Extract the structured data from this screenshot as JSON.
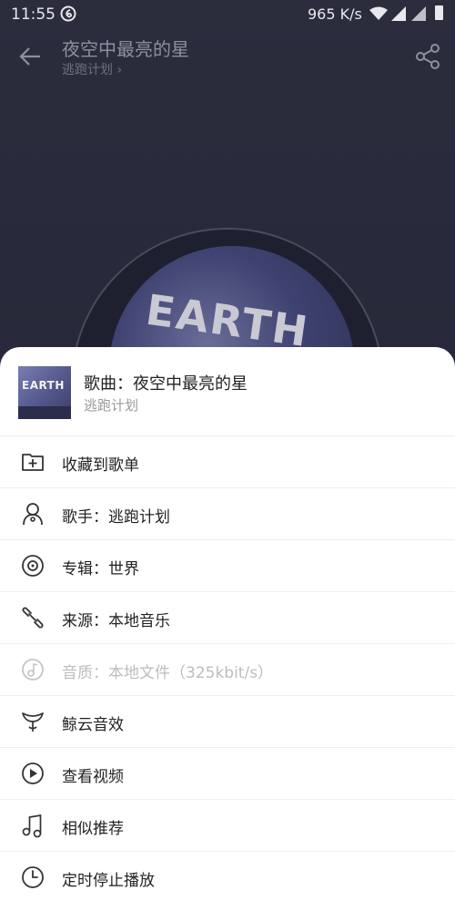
{
  "status_bar": {
    "time": "11:55",
    "speed": "965 K/s"
  },
  "header": {
    "song_title": "夜空中最亮的星",
    "artist": "逃跑计划 ›"
  },
  "disc": {
    "art_text": "EARTH"
  },
  "sheet": {
    "cover_text": "EARTH",
    "title": "歌曲：夜空中最亮的星",
    "subtitle": "逃跑计划",
    "items": [
      {
        "label": "收藏到歌单",
        "icon": "folder-add-icon",
        "enabled": true
      },
      {
        "label": "歌手：逃跑计划",
        "icon": "artist-icon",
        "enabled": true
      },
      {
        "label": "专辑：世界",
        "icon": "album-icon",
        "enabled": true
      },
      {
        "label": "来源：本地音乐",
        "icon": "link-icon",
        "enabled": true
      },
      {
        "label": "音质：本地文件（325kbit/s）",
        "icon": "quality-icon",
        "enabled": false
      },
      {
        "label": "鲸云音效",
        "icon": "sound-effect-icon",
        "enabled": true
      },
      {
        "label": "查看视频",
        "icon": "video-icon",
        "enabled": true
      },
      {
        "label": "相似推荐",
        "icon": "music-note-icon",
        "enabled": true
      },
      {
        "label": "定时停止播放",
        "icon": "clock-icon",
        "enabled": true
      }
    ]
  }
}
